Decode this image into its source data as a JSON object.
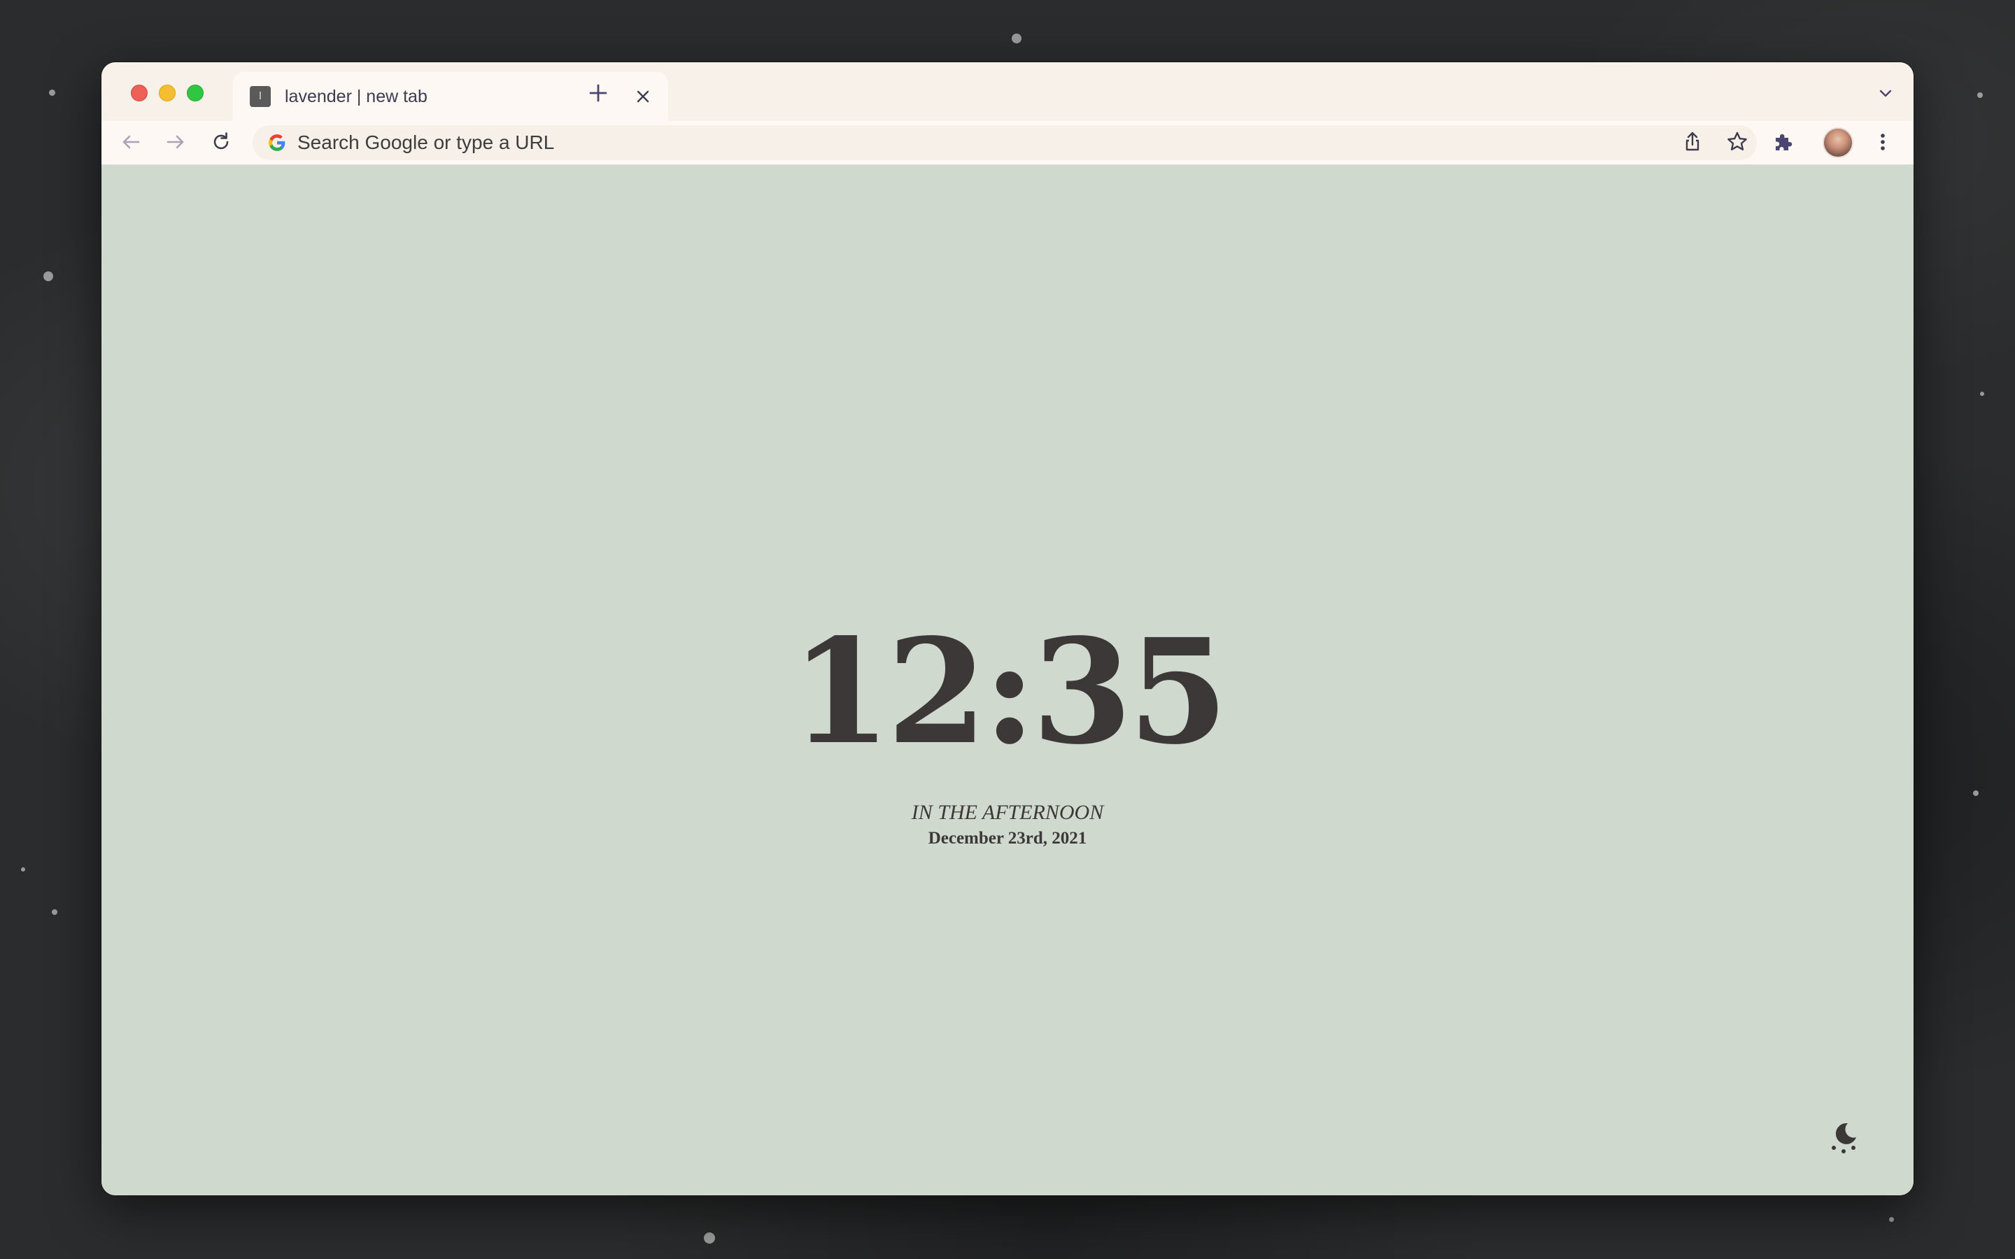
{
  "browser": {
    "tab": {
      "favicon_letter": "l",
      "title": "lavender | new tab"
    },
    "omnibox": {
      "placeholder": "Search Google or type a URL"
    },
    "colors": {
      "frame": "#f7f1ea",
      "toolbar": "#fdf8f3",
      "accent_icon": "#4b4572"
    }
  },
  "page": {
    "clock": {
      "time": "12:35",
      "period": "IN THE AFTERNOON",
      "date": "December 23rd, 2021"
    },
    "colors": {
      "background": "#cfd9cd",
      "text": "#3c3837"
    }
  }
}
